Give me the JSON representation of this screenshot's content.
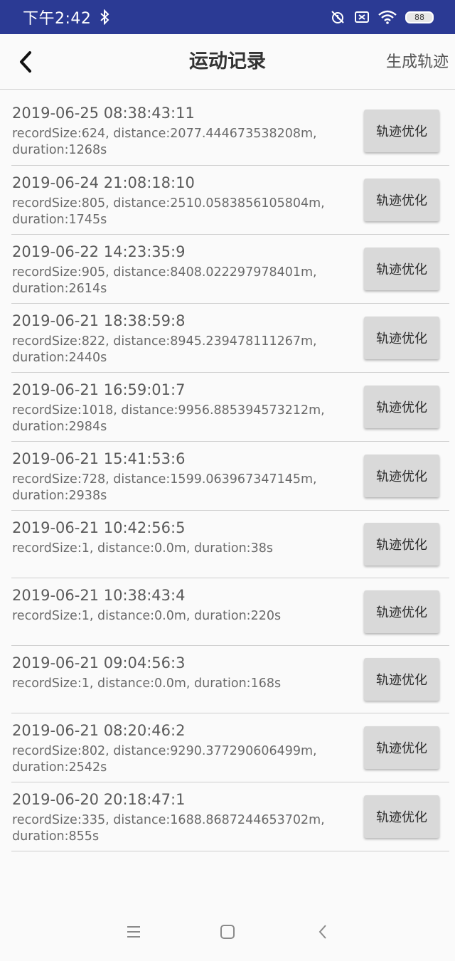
{
  "status_bar": {
    "time": "下午2:42",
    "battery_level": "88"
  },
  "toolbar": {
    "title": "运动记录",
    "action_label": "生成轨迹"
  },
  "records": [
    {
      "date": "2019-06-25 08:38:43:11",
      "info": "recordSize:624, distance:2077.444673538208m, duration:1268s",
      "button_label": "轨迹优化"
    },
    {
      "date": "2019-06-24 21:08:18:10",
      "info": "recordSize:805, distance:2510.0583856105804m, duration:1745s",
      "button_label": "轨迹优化"
    },
    {
      "date": "2019-06-22 14:23:35:9",
      "info": "recordSize:905, distance:8408.022297978401m, duration:2614s",
      "button_label": "轨迹优化"
    },
    {
      "date": "2019-06-21 18:38:59:8",
      "info": "recordSize:822, distance:8945.239478111267m, duration:2440s",
      "button_label": "轨迹优化"
    },
    {
      "date": "2019-06-21 16:59:01:7",
      "info": "recordSize:1018, distance:9956.885394573212m, duration:2984s",
      "button_label": "轨迹优化"
    },
    {
      "date": "2019-06-21 15:41:53:6",
      "info": "recordSize:728, distance:1599.063967347145m, duration:2938s",
      "button_label": "轨迹优化"
    },
    {
      "date": "2019-06-21 10:42:56:5",
      "info": "recordSize:1, distance:0.0m, duration:38s",
      "button_label": "轨迹优化"
    },
    {
      "date": "2019-06-21 10:38:43:4",
      "info": "recordSize:1, distance:0.0m, duration:220s",
      "button_label": "轨迹优化"
    },
    {
      "date": "2019-06-21 09:04:56:3",
      "info": "recordSize:1, distance:0.0m, duration:168s",
      "button_label": "轨迹优化"
    },
    {
      "date": "2019-06-21 08:20:46:2",
      "info": "recordSize:802, distance:9290.377290606499m, duration:2542s",
      "button_label": "轨迹优化"
    },
    {
      "date": "2019-06-20 20:18:47:1",
      "info": "recordSize:335, distance:1688.8687244653702m, duration:855s",
      "button_label": "轨迹优化"
    }
  ],
  "icons": {
    "back": "back-arrow-icon",
    "bluetooth": "bluetooth-icon",
    "alarm_off": "alarm-off-icon",
    "sim": "no-sim-icon",
    "wifi": "wifi-icon",
    "menu": "menu-icon",
    "home": "home-icon",
    "nav_back": "nav-back-icon"
  }
}
